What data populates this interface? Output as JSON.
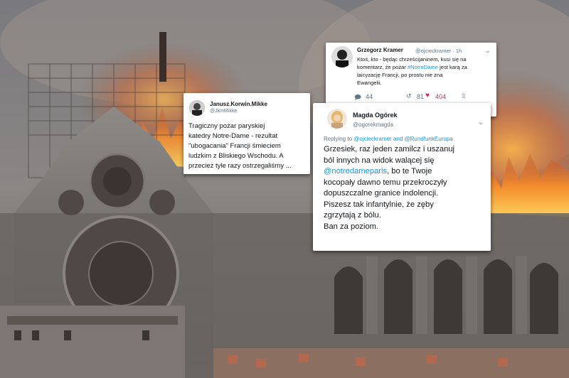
{
  "colors": {
    "link": "#1b95e0",
    "like": "#e0245e",
    "text": "#14171a",
    "muted": "#657786"
  },
  "tweet_korwin": {
    "name": "Janusz.Korwin.Mikke",
    "handle": "@JkmMikke",
    "text": "Tragiczny pożar paryskiej katedry Notre-Dame - rezultat \"ubogacania\" Francji śmieciem ludzkim z Bliskiego Wschodu. A przecież tyle razy ostrzegaliśmy ...",
    "lines": [
      "Tragiczny pożar paryskiej",
      "katedry Notre-Dame - rezultat",
      "\"ubogacania\" Francji śmieciem",
      "ludzkim z Bliskiego Wschodu. A",
      "przecież tyle razy ostrzegaliśmy ..."
    ]
  },
  "tweet_kramer": {
    "name": "Grzegorz Kramer",
    "handle": "@ojcieckramer · 1h",
    "text_parts": {
      "line1": "Ktoś, kto - będąc chrześcijaninem, kusi się na",
      "line2_before": "komentarz, że pożar ",
      "hashtag": "#NotreDame",
      "line2_after": " jest karą za",
      "line3": "laicyzację Francji, po prostu nie zna",
      "line4": "Ewangelii."
    },
    "reply_icon": "reply-icon",
    "retweet_icon": "retweet-icon",
    "like_icon": "heart-icon",
    "share_icon": "share-icon",
    "replies": "44",
    "retweets": "81",
    "likes": "404"
  },
  "tweet_ogorek": {
    "name": "Magda Ogórek",
    "handle": "@ogorekmagda",
    "replying_label": "Replying to ",
    "replying_to": "@ojcieckramer and @RundfunkEuropa",
    "line1": "Grzesiek, raz jeden zamilcz i uszanuj",
    "line2": "ból innych na widok walącej się",
    "mention": "@notredameparis",
    "line3_after": ", bo te Twoje",
    "line4": "kocopały dawno temu przekroczyły",
    "line5": "dopuszczalne granice indolencji.",
    "line6": "Piszesz tak infantylnie, że zęby",
    "line7": "zgrzytają z bólu.",
    "line8": "Ban za poziom."
  }
}
